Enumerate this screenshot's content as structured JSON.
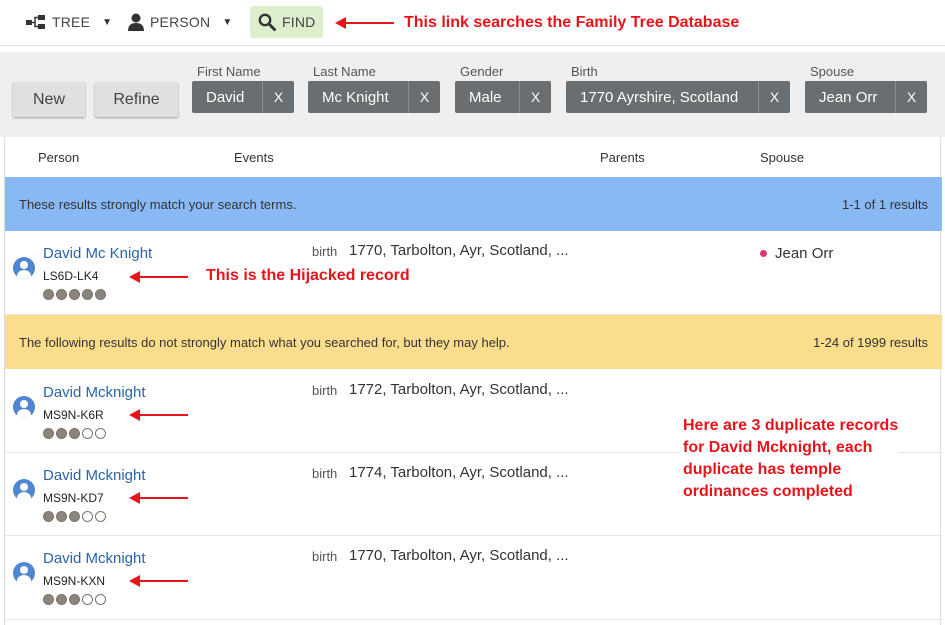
{
  "nav": {
    "tree_label": "TREE",
    "person_label": "PERSON",
    "find_label": "FIND",
    "tree_icon": "tree-icon",
    "person_icon": "person-icon",
    "find_icon": "search-icon"
  },
  "annotations": {
    "find_note": "This link searches the Family Tree Database",
    "hijacked_note": "This is the Hijacked record",
    "duplicates_note": "Here are 3 duplicate records for David Mcknight, each duplicate has temple ordinances completed"
  },
  "refine": {
    "new_label": "New",
    "refine_label": "Refine",
    "fields": [
      {
        "label": "First Name",
        "value": "David"
      },
      {
        "label": "Last Name",
        "value": "Mc Knight"
      },
      {
        "label": "Gender",
        "value": "Male"
      },
      {
        "label": "Birth",
        "value": "1770 Ayrshire, Scotland"
      },
      {
        "label": "Spouse",
        "value": "Jean Orr"
      }
    ],
    "remove_glyph": "X"
  },
  "columns": {
    "person": "Person",
    "events": "Events",
    "parents": "Parents",
    "spouse": "Spouse"
  },
  "strong_banner": {
    "text": "These results strongly match your search terms.",
    "count": "1-1 of 1 results"
  },
  "weak_banner": {
    "text": "The following results do not strongly match what you searched for, but they may help.",
    "count": "1-24 of 1999 results"
  },
  "results": [
    {
      "name": "David Mc Knight",
      "id": "LS6D-LK4",
      "event_type": "birth",
      "event": "1770, Tarbolton, Ayr, Scotland, ...",
      "spouse": "Jean Orr",
      "score": 5
    },
    {
      "name": "David Mcknight",
      "id": "MS9N-K6R",
      "event_type": "birth",
      "event": "1772, Tarbolton, Ayr, Scotland, ...",
      "spouse": "",
      "score": 3
    },
    {
      "name": "David Mcknight",
      "id": "MS9N-KD7",
      "event_type": "birth",
      "event": "1774, Tarbolton, Ayr, Scotland, ...",
      "spouse": "",
      "score": 3
    },
    {
      "name": "David Mcknight",
      "id": "MS9N-KXN",
      "event_type": "birth",
      "event": "1770, Tarbolton, Ayr, Scotland, ...",
      "spouse": "",
      "score": 3
    }
  ],
  "colors": {
    "accent_find": "#dceecb",
    "banner_blue": "#89b9f5",
    "banner_yellow": "#fbdd8e",
    "annotation_red": "#e8141c",
    "link_blue": "#2a64a8"
  }
}
